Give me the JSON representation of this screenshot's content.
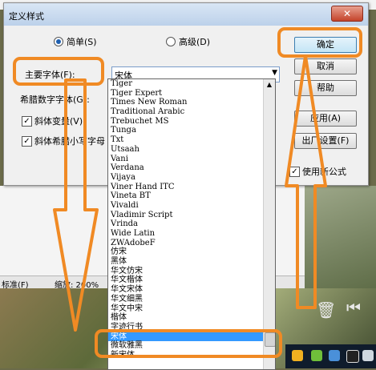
{
  "dialog": {
    "title": "定义样式",
    "close_glyph": "✕",
    "radio_simple": "简单(S)",
    "radio_advanced": "高级(D)",
    "main_font_label": "主要字体(F):",
    "font_value": "宋体",
    "greek_label": "希腊数字字体(G):",
    "chk_italic_var": "斜体变量(V)",
    "chk_italic_greek": "斜体希腊小写字母",
    "chk_use_new": "使用新公式",
    "btn_ok": "确定",
    "btn_cancel": "取消",
    "btn_help": "帮助",
    "btn_apply": "应用(A)",
    "btn_factory": "出厂设置(F)"
  },
  "status": {
    "left": "标准(F)",
    "zoom": "缩放: 200%"
  },
  "font_list": [
    "Tiger",
    "Tiger Expert",
    "Times New Roman",
    "Traditional Arabic",
    "Trebuchet MS",
    "Tunga",
    "Txt",
    "Utsaah",
    "Vani",
    "Verdana",
    "Vijaya",
    "Viner Hand ITC",
    "Vineta BT",
    "Vivaldi",
    "Vladimir Script",
    "Vrinda",
    "Wide Latin",
    "ZWAdobeF",
    "仿宋",
    "黑体",
    "华文仿宋",
    "华文楷体",
    "华文宋体",
    "华文细黑",
    "华文中宋",
    "楷体",
    "字迹行书",
    "宋体",
    "微软雅黑",
    "新宋体"
  ],
  "selected_index": 27,
  "colors": {
    "annotation": "#f08a24",
    "selection": "#3399ff"
  }
}
